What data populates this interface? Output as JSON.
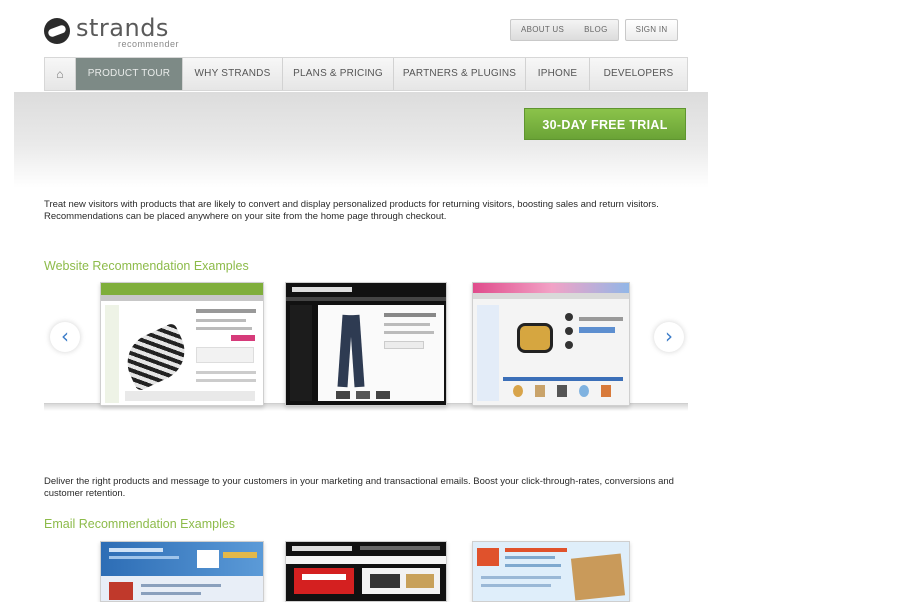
{
  "header": {
    "logo_text": "strands",
    "logo_sub": "recommender",
    "links": [
      "ABOUT US",
      "BLOG"
    ],
    "signin": "SIGN IN"
  },
  "nav": {
    "items": [
      {
        "label": "⌂",
        "icon": "home-icon"
      },
      {
        "label": "PRODUCT TOUR",
        "active": true
      },
      {
        "label": "WHY STRANDS"
      },
      {
        "label": "PLANS & PRICING"
      },
      {
        "label": "PARTNERS & PLUGINS"
      },
      {
        "label": "IPHONE"
      },
      {
        "label": "DEVELOPERS"
      }
    ]
  },
  "banner": {
    "cta": "30-DAY FREE TRIAL"
  },
  "content": {
    "website_paragraph": "Treat new visitors with products that are likely to convert and display personalized products for returning visitors, boosting sales and return visitors. Recommendations can be placed anywhere on your site from the home page through checkout.",
    "website_title": "Website Recommendation Examples",
    "email_paragraph": "Deliver the right products and message to your customers in your marketing and transactional emails. Boost your click-through-rates, conversions and customer retention.",
    "email_title": "Email Recommendation Examples"
  },
  "carousel": {
    "prev": "‹",
    "next": "›"
  },
  "colors": {
    "accent_green": "#8dbb4a",
    "cta_green": "#6aa336",
    "nav_active": "#7d8a86",
    "arrow_blue": "#3a7bc8"
  }
}
